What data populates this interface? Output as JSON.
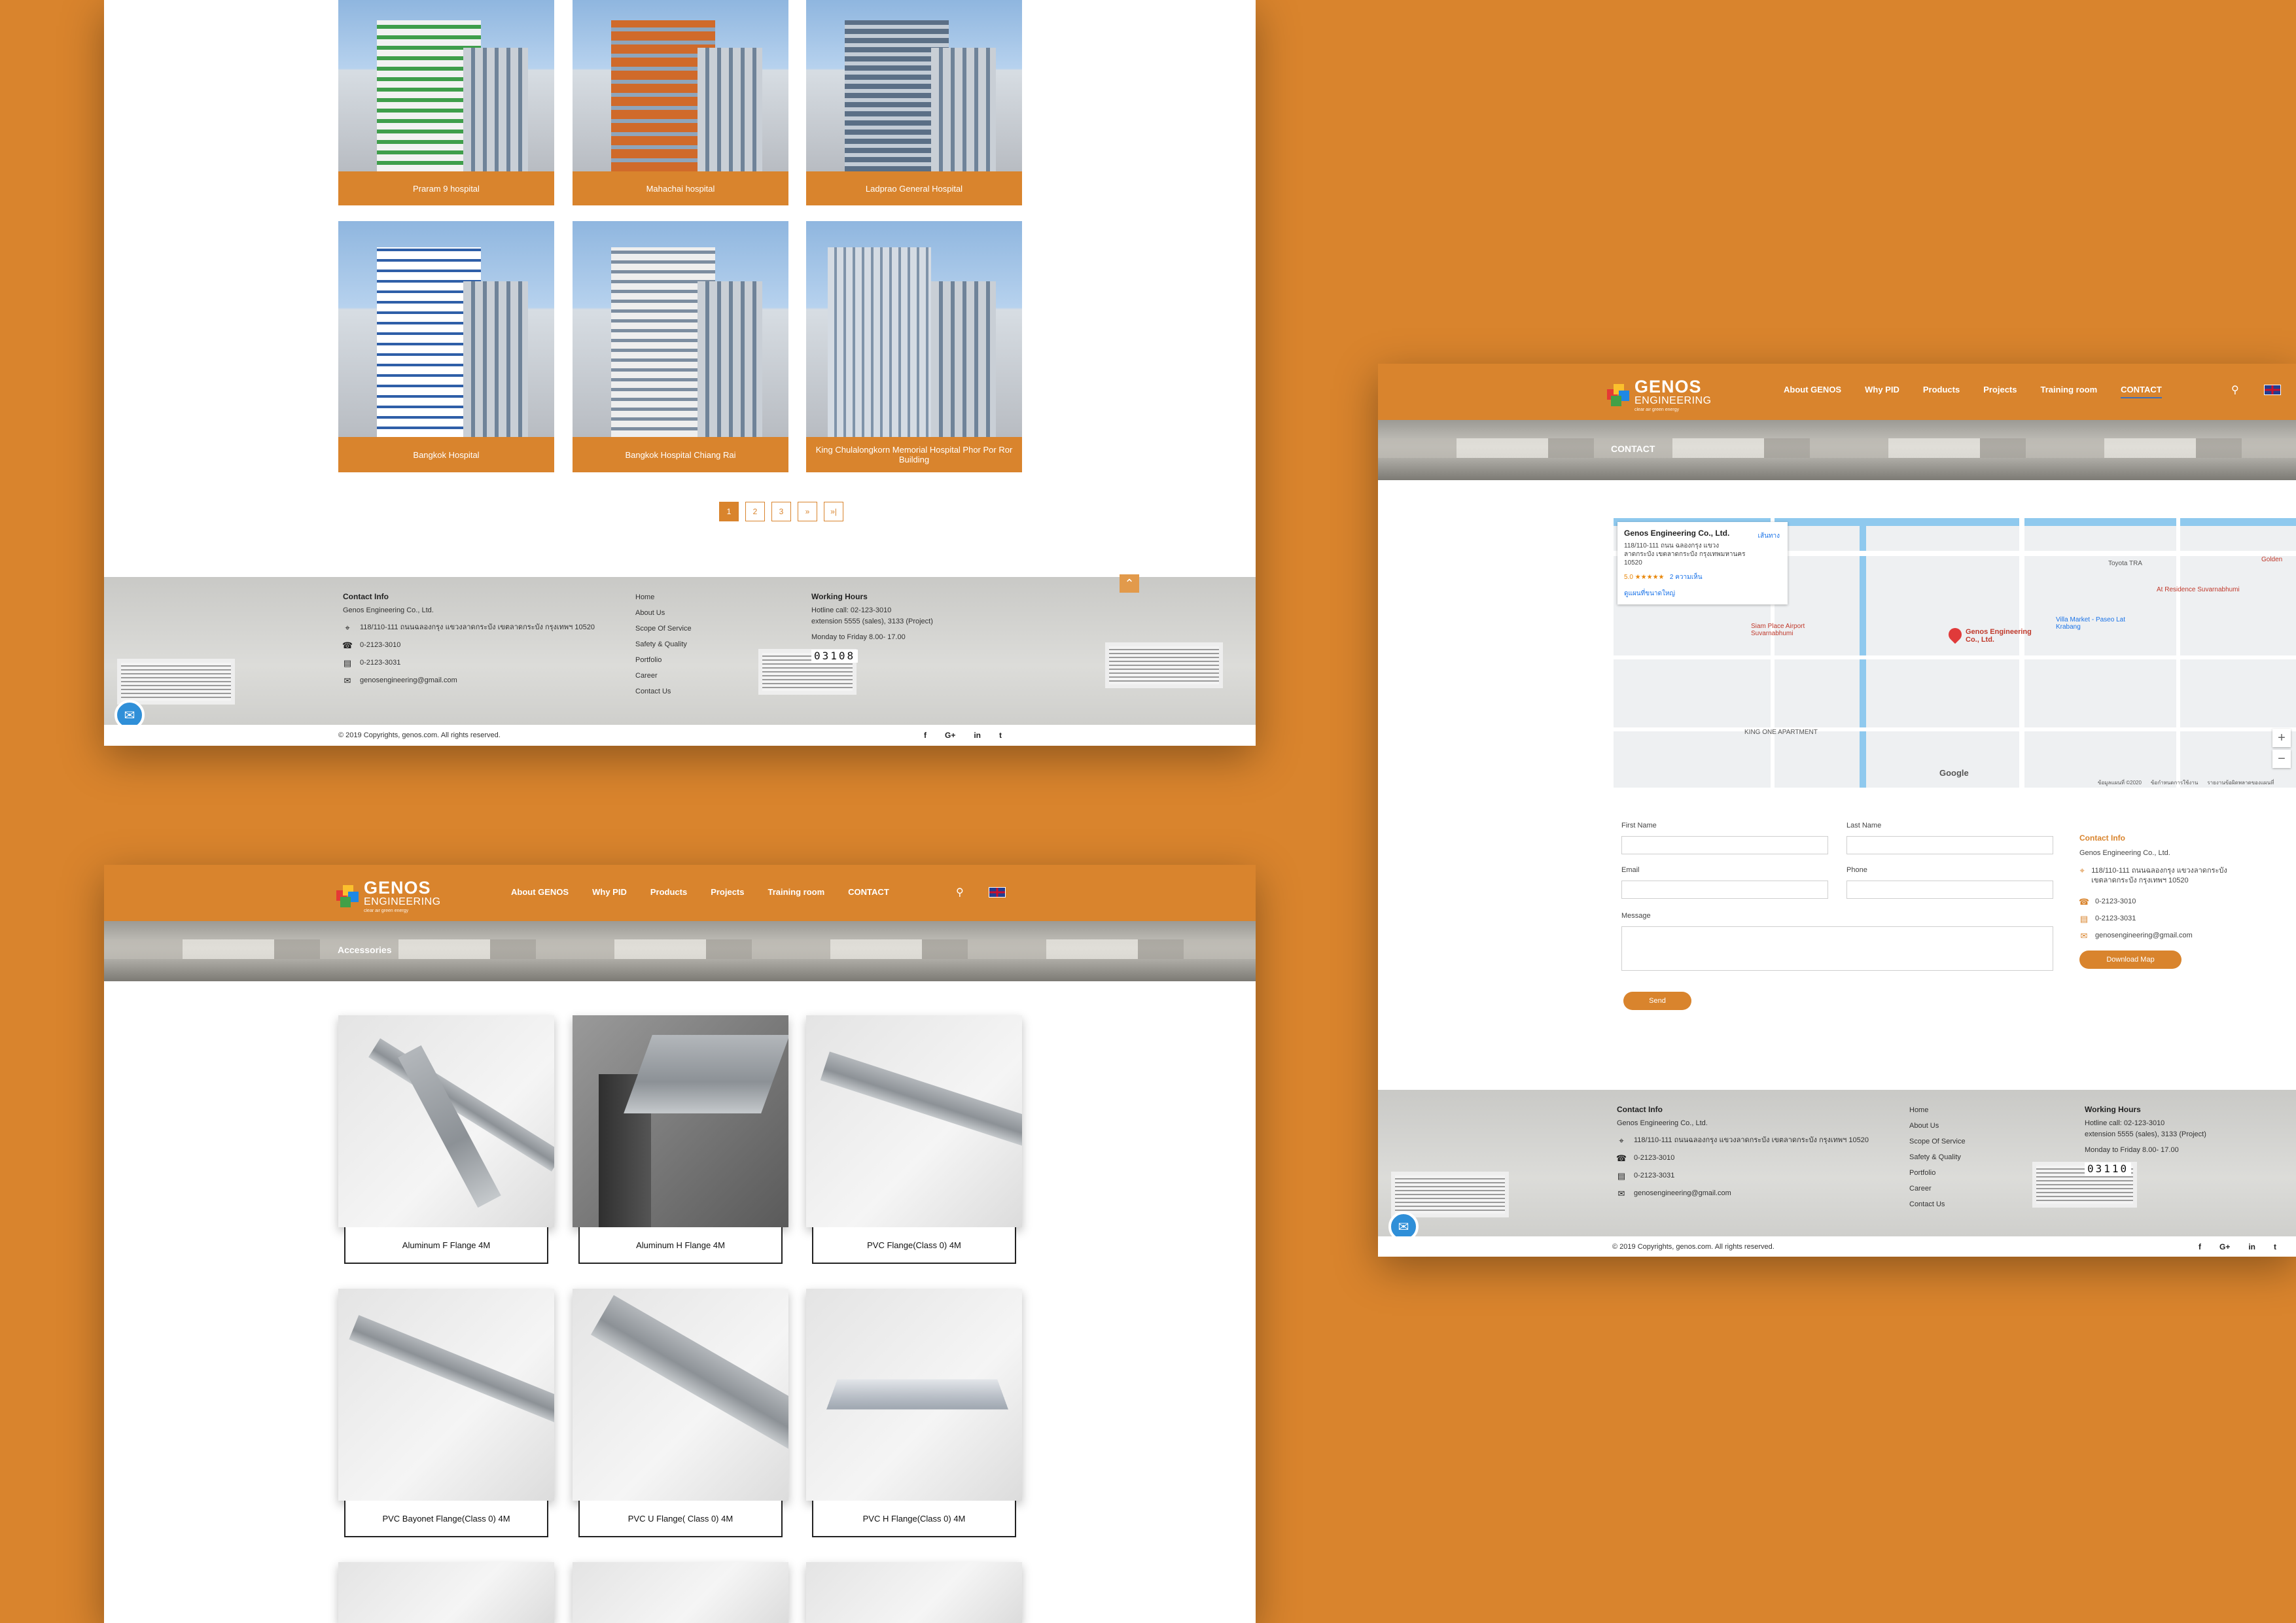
{
  "nav": {
    "about": "About GENOS",
    "why": "Why PID",
    "products": "Products",
    "projects": "Projects",
    "training": "Training room",
    "contact": "CONTACT"
  },
  "logo": {
    "name": "GENOS",
    "sub": "ENGINEERING",
    "tagline": "clear air green energy"
  },
  "projects": {
    "cards": [
      {
        "label": "Praram 9 hospital"
      },
      {
        "label": "Mahachai hospital"
      },
      {
        "label": "Ladprao General Hospital"
      },
      {
        "label": "Bangkok Hospital"
      },
      {
        "label": "Bangkok Hospital Chiang Rai"
      },
      {
        "label": "King Chulalongkorn Memorial Hospital Phor Por Ror Building"
      }
    ],
    "pagination": [
      "1",
      "2",
      "3",
      "»",
      "»|"
    ]
  },
  "footer": {
    "contact_heading": "Contact Info",
    "company": "Genos Engineering Co., Ltd.",
    "address": "118/110-111 ถนนฉลองกรุง แขวงลาดกระบัง เขตลาดกระบัง กรุงเทพฯ 10520",
    "phone": "0-2123-3010",
    "fax": "0-2123-3031",
    "email": "genosengineering@gmail.com",
    "links": [
      "Home",
      "About Us",
      "Scope Of Service",
      "Safety & Quality",
      "Portfolio",
      "Career",
      "Contact Us"
    ],
    "hours_heading": "Working Hours",
    "hotline": "Hotline call: 02-123-3010",
    "extension": "extension 5555 (sales), 3133 (Project)",
    "days": "Monday to Friday 8.00- 17.00",
    "counter_projects": "03108",
    "counter_contact": "03110",
    "copyright": "© 2019 Copyrights, genos.com. All rights reserved.",
    "social": [
      "f",
      "G+",
      "in",
      "t"
    ]
  },
  "contact": {
    "banner_title": "CONTACT",
    "map": {
      "place": "Genos Engineering Co., Ltd.",
      "address": "118/110-111 ถนน ฉลองกรุง แขวง ลาดกระบัง เขตลาดกระบัง กรุงเทพมหานคร 10520",
      "directions": "เส้นทาง",
      "rating": "5.0 ★★★★★",
      "reviews": "2 ความเห็น",
      "larger_map": "ดูแผนที่ขนาดใหญ่",
      "pin_label": "Genos Engineering Co., Ltd.",
      "labels": [
        "Siam Place Airport Suvarnabhumi",
        "Villa Market - Paseo Lat Krabang",
        "At Residence Suvarnabhumi",
        "KING ONE APARTMENT",
        "Toyota TRA",
        "Golden"
      ],
      "google": "Google",
      "attribution": "ข้อมูลแผนที่ ©2020",
      "terms": "ข้อกำหนดการใช้งาน",
      "report": "รายงานข้อผิดพลาดของแผนที่"
    },
    "form": {
      "first_name": "First Name",
      "last_name": "Last Name",
      "email": "Email",
      "phone": "Phone",
      "message": "Message",
      "send": "Send"
    },
    "info": {
      "heading": "Contact Info",
      "company": "Genos Engineering Co., Ltd.",
      "address": "118/110-111 ถนนฉลองกรุง แขวงลาดกระบัง เขตลาดกระบัง กรุงเทพฯ 10520",
      "phone": "0-2123-3010",
      "fax": "0-2123-3031",
      "email": "genosengineering@gmail.com",
      "download": "Download Map"
    }
  },
  "accessories": {
    "banner_title": "Accessories",
    "items": [
      {
        "label": "Aluminum F Flange 4M"
      },
      {
        "label": "Aluminum H Flange 4M"
      },
      {
        "label": "PVC Flange(Class 0) 4M"
      },
      {
        "label": "PVC Bayonet Flange(Class 0) 4M"
      },
      {
        "label": "PVC U Flange( Class 0) 4M"
      },
      {
        "label": "PVC H Flange(Class 0) 4M"
      }
    ]
  },
  "colors": {
    "accent": "#d9842d",
    "chat": "#2f8fd8"
  },
  "icons": [
    "map-marker-icon",
    "phone-icon",
    "fax-icon",
    "mail-icon",
    "search-icon",
    "chat-icon",
    "arrow-up-icon",
    "flag-uk-icon"
  ]
}
